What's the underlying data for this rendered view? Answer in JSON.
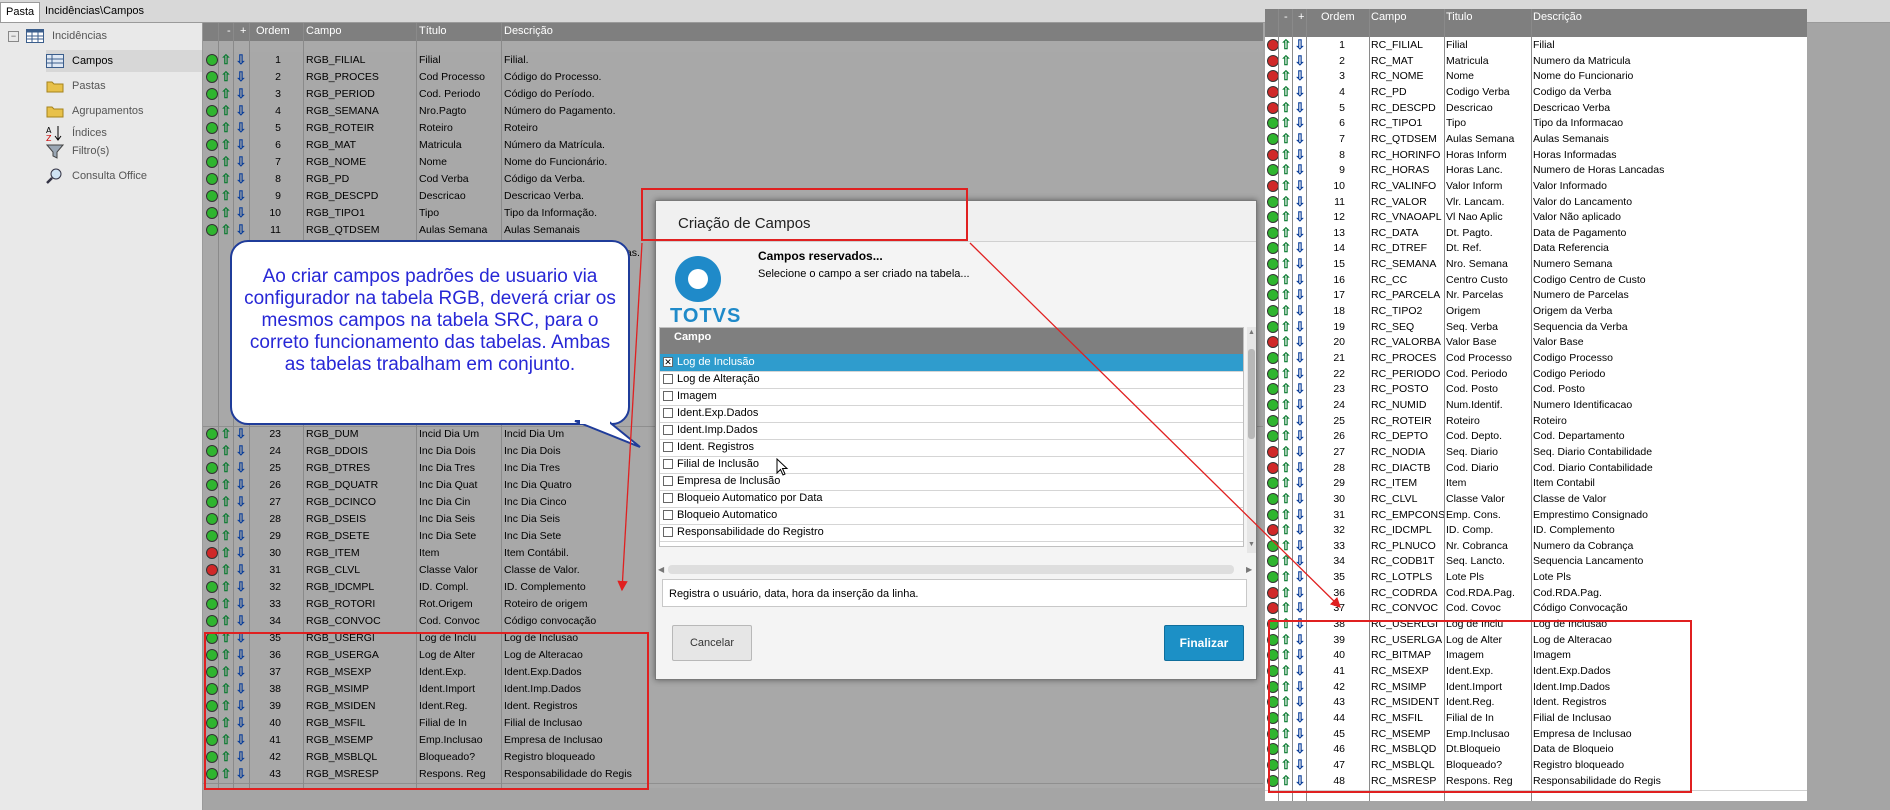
{
  "tabs": [
    "Pasta",
    "Incidências\\Campos"
  ],
  "tree": [
    {
      "label": "Incidências",
      "icon": "table-icon"
    },
    {
      "label": "Campos",
      "icon": "grid-icon"
    },
    {
      "label": "Pastas",
      "icon": "folder-icon"
    },
    {
      "label": "Agrupamentos",
      "icon": "folder-icon"
    },
    {
      "label": "Índices",
      "icon": "sort-az-icon"
    },
    {
      "label": "Filtro(s)",
      "icon": "filter-icon"
    },
    {
      "label": "Consulta Office",
      "icon": "magnifier-icon"
    }
  ],
  "columns": {
    "minus": "-",
    "plus": "+",
    "order": "Ordem",
    "field": "Campo",
    "title": "Título",
    "desc": "Descrição"
  },
  "columnsB": {
    "minus": "-",
    "plus": "+",
    "order": "Ordem",
    "field": "Campo",
    "title": "Titulo",
    "desc": "Descrição"
  },
  "colors": {
    "green": "#2fb52f",
    "red": "#d02828",
    "accent": "#1f8ac9",
    "callout_text": "#2727d6",
    "highlight": "#e02020"
  },
  "rgb_rows": [
    [
      "g",
      "1",
      "RGB_FILIAL",
      "Filial",
      "Filial."
    ],
    [
      "g",
      "2",
      "RGB_PROCES",
      "Cod Processo",
      "Código do Processo."
    ],
    [
      "g",
      "3",
      "RGB_PERIOD",
      "Cod. Periodo",
      "Código do Período."
    ],
    [
      "g",
      "4",
      "RGB_SEMANA",
      "Nro.Pagto",
      "Número do Pagamento."
    ],
    [
      "g",
      "5",
      "RGB_ROTEIR",
      "Roteiro",
      "Roteiro"
    ],
    [
      "g",
      "6",
      "RGB_MAT",
      "Matricula",
      "Número da Matrícula."
    ],
    [
      "g",
      "7",
      "RGB_NOME",
      "Nome",
      "Nome do Funcionário."
    ],
    [
      "g",
      "8",
      "RGB_PD",
      "Cod Verba",
      "Código da Verba."
    ],
    [
      "g",
      "9",
      "RGB_DESCPD",
      "Descricao",
      "Descricao Verba."
    ],
    [
      "g",
      "10",
      "RGB_TIPO1",
      "Tipo",
      "Tipo da Informação."
    ],
    [
      "g",
      "11",
      "RGB_QTDSEM",
      "Aulas Semana",
      "Aulas Semanais"
    ],
    [
      "g",
      "23",
      "RGB_DUM",
      "Incid Dia Um",
      "Incid Dia Um"
    ],
    [
      "g",
      "24",
      "RGB_DDOIS",
      "Inc Dia Dois",
      "Inc Dia Dois"
    ],
    [
      "g",
      "25",
      "RGB_DTRES",
      "Inc Dia Tres",
      "Inc Dia Tres"
    ],
    [
      "g",
      "26",
      "RGB_DQUATR",
      "Inc Dia Quat",
      "Inc Dia Quatro"
    ],
    [
      "g",
      "27",
      "RGB_DCINCO",
      "Inc Dia Cin",
      "Inc Dia Cinco"
    ],
    [
      "g",
      "28",
      "RGB_DSEIS",
      "Inc Dia Seis",
      "Inc Dia Seis"
    ],
    [
      "g",
      "29",
      "RGB_DSETE",
      "Inc Dia Sete",
      "Inc Dia Sete"
    ],
    [
      "r",
      "30",
      "RGB_ITEM",
      "Item",
      "Item Contábil."
    ],
    [
      "r",
      "31",
      "RGB_CLVL",
      "Classe Valor",
      "Classe de Valor."
    ],
    [
      "g",
      "32",
      "RGB_IDCMPL",
      "ID. Compl.",
      "ID. Complemento"
    ],
    [
      "g",
      "33",
      "RGB_ROTORI",
      "Rot.Origem",
      "Roteiro de origem"
    ],
    [
      "g",
      "34",
      "RGB_CONVOC",
      "Cod. Convoc",
      "Código convocação"
    ],
    [
      "g",
      "35",
      "RGB_USERGI",
      "Log de Inclu",
      "Log de Inclusao"
    ],
    [
      "g",
      "36",
      "RGB_USERGA",
      "Log de Alter",
      "Log de Alteracao"
    ],
    [
      "g",
      "37",
      "RGB_MSEXP",
      "Ident.Exp.",
      "Ident.Exp.Dados"
    ],
    [
      "g",
      "38",
      "RGB_MSIMP",
      "Ident.Import",
      "Ident.Imp.Dados"
    ],
    [
      "g",
      "39",
      "RGB_MSIDEN",
      "Ident.Reg.",
      "Ident. Registros"
    ],
    [
      "g",
      "40",
      "RGB_MSFIL",
      "Filial de In",
      "Filial de Inclusao"
    ],
    [
      "g",
      "41",
      "RGB_MSEMP",
      "Emp.Inclusao",
      "Empresa de Inclusao"
    ],
    [
      "g",
      "42",
      "RGB_MSBLQL",
      "Bloqueado?",
      "Registro bloqueado"
    ],
    [
      "g",
      "43",
      "RGB_MSRESP",
      "Respons. Reg",
      "Responsabilidade do Regis"
    ]
  ],
  "rgb_overflow": ".as.",
  "rc_rows": [
    [
      "r",
      "1",
      "RC_FILIAL",
      "Filial",
      "Filial"
    ],
    [
      "r",
      "2",
      "RC_MAT",
      "Matricula",
      "Numero da Matricula"
    ],
    [
      "r",
      "3",
      "RC_NOME",
      "Nome",
      "Nome do Funcionario"
    ],
    [
      "r",
      "4",
      "RC_PD",
      "Codigo Verba",
      "Codigo da Verba"
    ],
    [
      "r",
      "5",
      "RC_DESCPD",
      "Descricao",
      "Descricao Verba"
    ],
    [
      "g",
      "6",
      "RC_TIPO1",
      "Tipo",
      "Tipo da Informacao"
    ],
    [
      "g",
      "7",
      "RC_QTDSEM",
      "Aulas Semana",
      "Aulas Semanais"
    ],
    [
      "r",
      "8",
      "RC_HORINFO",
      "Horas Inform",
      "Horas Informadas"
    ],
    [
      "g",
      "9",
      "RC_HORAS",
      "Horas Lanc.",
      "Numero de Horas Lancadas"
    ],
    [
      "r",
      "10",
      "RC_VALINFO",
      "Valor Inform",
      "Valor Informado"
    ],
    [
      "g",
      "11",
      "RC_VALOR",
      "Vlr. Lancam.",
      "Valor do Lancamento"
    ],
    [
      "g",
      "12",
      "RC_VNAOAPL",
      "Vl Nao Aplic",
      "Valor Não aplicado"
    ],
    [
      "g",
      "13",
      "RC_DATA",
      "Dt. Pagto.",
      "Data de Pagamento"
    ],
    [
      "g",
      "14",
      "RC_DTREF",
      "Dt. Ref.",
      "Data Referencia"
    ],
    [
      "g",
      "15",
      "RC_SEMANA",
      "Nro. Semana",
      "Numero Semana"
    ],
    [
      "g",
      "16",
      "RC_CC",
      "Centro Custo",
      "Codigo Centro de Custo"
    ],
    [
      "g",
      "17",
      "RC_PARCELA",
      "Nr. Parcelas",
      "Numero de Parcelas"
    ],
    [
      "g",
      "18",
      "RC_TIPO2",
      "Origem",
      "Origem da Verba"
    ],
    [
      "g",
      "19",
      "RC_SEQ",
      "Seq. Verba",
      "Sequencia da Verba"
    ],
    [
      "r",
      "20",
      "RC_VALORBA",
      "Valor Base",
      "Valor Base"
    ],
    [
      "g",
      "21",
      "RC_PROCES",
      "Cod Processo",
      "Codigo Processo"
    ],
    [
      "g",
      "22",
      "RC_PERIODO",
      "Cod. Periodo",
      "Codigo Periodo"
    ],
    [
      "g",
      "23",
      "RC_POSTO",
      "Cod. Posto",
      "Cod. Posto"
    ],
    [
      "g",
      "24",
      "RC_NUMID",
      "Num.Identif.",
      "Numero Identificacao"
    ],
    [
      "g",
      "25",
      "RC_ROTEIR",
      "Roteiro",
      "Roteiro"
    ],
    [
      "g",
      "26",
      "RC_DEPTO",
      "Cod. Depto.",
      "Cod. Departamento"
    ],
    [
      "r",
      "27",
      "RC_NODIA",
      "Seq. Diario",
      "Seq. Diario Contabilidade"
    ],
    [
      "r",
      "28",
      "RC_DIACTB",
      "Cod. Diario",
      "Cod. Diario Contabilidade"
    ],
    [
      "g",
      "29",
      "RC_ITEM",
      "Item",
      "Item Contabil"
    ],
    [
      "g",
      "30",
      "RC_CLVL",
      "Classe Valor",
      "Classe de Valor"
    ],
    [
      "g",
      "31",
      "RC_EMPCONS",
      "Emp. Cons.",
      "Emprestimo Consignado"
    ],
    [
      "r",
      "32",
      "RC_IDCMPL",
      "ID. Comp.",
      "ID. Complemento"
    ],
    [
      "g",
      "33",
      "RC_PLNUCO",
      "Nr. Cobranca",
      "Numero da Cobrança"
    ],
    [
      "g",
      "34",
      "RC_CODB1T",
      "Seq. Lancto.",
      "Sequencia Lancamento"
    ],
    [
      "g",
      "35",
      "RC_LOTPLS",
      "Lote Pls",
      "Lote Pls"
    ],
    [
      "r",
      "36",
      "RC_CODRDA",
      "Cod.RDA.Pag.",
      "Cod.RDA.Pag."
    ],
    [
      "r",
      "37",
      "RC_CONVOC",
      "Cod. Covoc",
      "Código Convocação"
    ],
    [
      "g",
      "38",
      "RC_USERLGI",
      "Log de Inclu",
      "Log de Inclusao"
    ],
    [
      "g",
      "39",
      "RC_USERLGA",
      "Log de Alter",
      "Log de Alteracao"
    ],
    [
      "g",
      "40",
      "RC_BITMAP",
      "Imagem",
      "Imagem"
    ],
    [
      "g",
      "41",
      "RC_MSEXP",
      "Ident.Exp.",
      "Ident.Exp.Dados"
    ],
    [
      "g",
      "42",
      "RC_MSIMP",
      "Ident.Import",
      "Ident.Imp.Dados"
    ],
    [
      "g",
      "43",
      "RC_MSIDENT",
      "Ident.Reg.",
      "Ident. Registros"
    ],
    [
      "g",
      "44",
      "RC_MSFIL",
      "Filial de In",
      "Filial de Inclusao"
    ],
    [
      "g",
      "45",
      "RC_MSEMP",
      "Emp.Inclusao",
      "Empresa de Inclusao"
    ],
    [
      "g",
      "46",
      "RC_MSBLQD",
      "Dt.Bloqueio",
      "Data de Bloqueio"
    ],
    [
      "g",
      "47",
      "RC_MSBLQL",
      "Bloqueado?",
      "Registro bloqueado"
    ],
    [
      "g",
      "48",
      "RC_MSRESP",
      "Respons. Reg",
      "Responsabilidade do Regis"
    ]
  ],
  "dialog": {
    "title": "Criação de Campos",
    "logo": "TOTVS",
    "heading": "Campos reservados...",
    "subheading": "Selecione o campo a ser criado na tabela...",
    "list_header": "Campo",
    "items": [
      {
        "label": "Log de Inclusão",
        "checked": true,
        "selected": true
      },
      {
        "label": "Log de Alteração",
        "checked": false
      },
      {
        "label": "Imagem",
        "checked": false
      },
      {
        "label": "Ident.Exp.Dados",
        "checked": false
      },
      {
        "label": "Ident.Imp.Dados",
        "checked": false
      },
      {
        "label": "Ident. Registros",
        "checked": false
      },
      {
        "label": "Filial de Inclusão",
        "checked": false
      },
      {
        "label": "Empresa de Inclusão",
        "checked": false
      },
      {
        "label": "Bloqueio Automatico por Data",
        "checked": false
      },
      {
        "label": "Bloqueio Automatico",
        "checked": false
      },
      {
        "label": "Responsabilidade do Registro",
        "checked": false
      }
    ],
    "description": "Registra o usuário, data, hora da inserção da linha.",
    "cancel": "Cancelar",
    "finish": "Finalizar"
  },
  "callout": "Ao criar campos padrões de usuario via configurador na tabela RGB, deverá criar os mesmos campos na tabela SRC, para o correto funcionamento das tabelas. Ambas as tabelas trabalham em conjunto."
}
